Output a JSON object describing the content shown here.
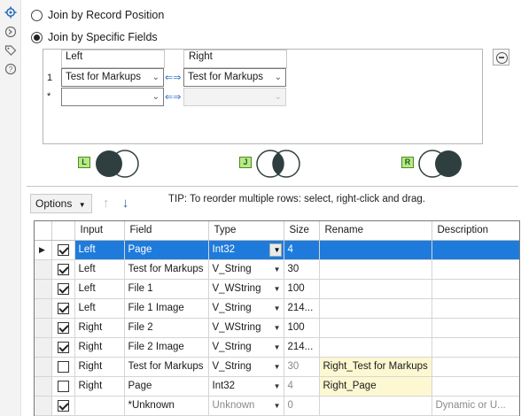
{
  "sidebar": {
    "icons": [
      "gear-icon",
      "arrow-circle-icon",
      "tag-icon",
      "help-icon"
    ]
  },
  "join_mode": {
    "option_position": "Join by Record Position",
    "option_fields": "Join by Specific Fields",
    "selected": "fields"
  },
  "join_fields": {
    "left_header": "Left",
    "right_header": "Right",
    "rows": [
      {
        "num": "1",
        "left": "Test for Markups",
        "right": "Test for Markups"
      },
      {
        "num": "*",
        "left": "",
        "right": ""
      }
    ]
  },
  "venn": {
    "left_anchor": "L",
    "join_anchor": "J",
    "right_anchor": "R"
  },
  "toolbar": {
    "options_label": "Options",
    "tip": "TIP: To reorder multiple rows: select, right-click and drag."
  },
  "grid": {
    "columns": [
      "Input",
      "Field",
      "Type",
      "Size",
      "Rename",
      "Description"
    ],
    "rows": [
      {
        "checked": true,
        "input": "Left",
        "field": "Page",
        "type": "Int32",
        "size": "4",
        "rename": "",
        "description": "",
        "selected": true
      },
      {
        "checked": true,
        "input": "Left",
        "field": "Test for Markups",
        "type": "V_String",
        "size": "30",
        "rename": "",
        "description": ""
      },
      {
        "checked": true,
        "input": "Left",
        "field": "File 1",
        "type": "V_WString",
        "size": "100",
        "rename": "",
        "description": ""
      },
      {
        "checked": true,
        "input": "Left",
        "field": "File 1 Image",
        "type": "V_String",
        "size": "214...",
        "rename": "",
        "description": ""
      },
      {
        "checked": true,
        "input": "Right",
        "field": "File 2",
        "type": "V_WString",
        "size": "100",
        "rename": "",
        "description": ""
      },
      {
        "checked": true,
        "input": "Right",
        "field": "File 2 Image",
        "type": "V_String",
        "size": "214...",
        "rename": "",
        "description": ""
      },
      {
        "checked": false,
        "input": "Right",
        "field": "Test for Markups",
        "type": "V_String",
        "size": "30",
        "rename": "Right_Test for Markups",
        "description": ""
      },
      {
        "checked": false,
        "input": "Right",
        "field": "Page",
        "type": "Int32",
        "size": "4",
        "rename": "Right_Page",
        "description": ""
      },
      {
        "checked": true,
        "input": "",
        "field": "*Unknown",
        "type": "Unknown",
        "size": "0",
        "rename": "",
        "description": "Dynamic or U..."
      }
    ]
  },
  "colors": {
    "selection": "#1f7bdb",
    "rename_bg": "#fdf8d2",
    "venn_dark": "#2f3f3f",
    "anchor_green": "#b8e986"
  }
}
